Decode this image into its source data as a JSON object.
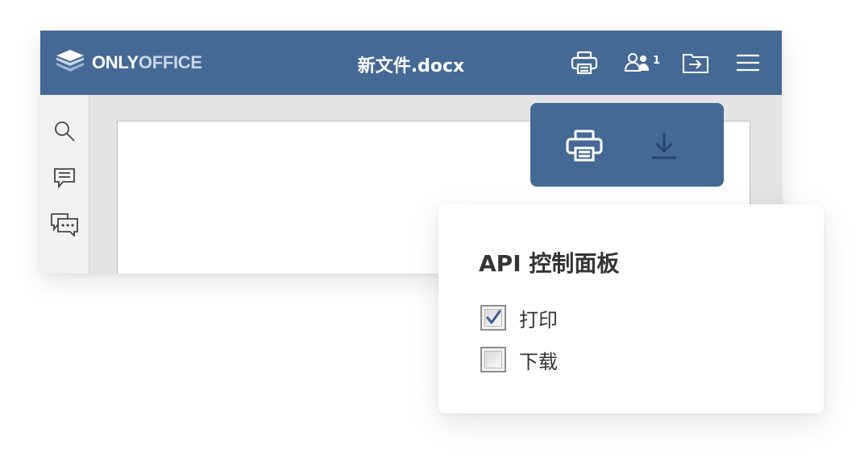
{
  "app": {
    "brand_main": "ONLY",
    "brand_accent": "OFFICE",
    "document_title": "新文件.docx",
    "users_count": "1"
  },
  "header_icons": [
    "print-icon",
    "users-icon",
    "open-location-icon",
    "menu-icon"
  ],
  "left_rail_icons": [
    "search-icon",
    "comment-icon",
    "chat-icon"
  ],
  "action_panel": {
    "buttons": [
      "print-icon",
      "download-icon"
    ]
  },
  "api_panel": {
    "title": "API 控制面板",
    "options": [
      {
        "label": "打印",
        "checked": true
      },
      {
        "label": "下载",
        "checked": false
      }
    ]
  },
  "colors": {
    "header": "#446995",
    "action_panel": "#446995",
    "editor_bg": "#e4e4e4",
    "check_mark": "#3b5f94",
    "text": "#333333"
  }
}
